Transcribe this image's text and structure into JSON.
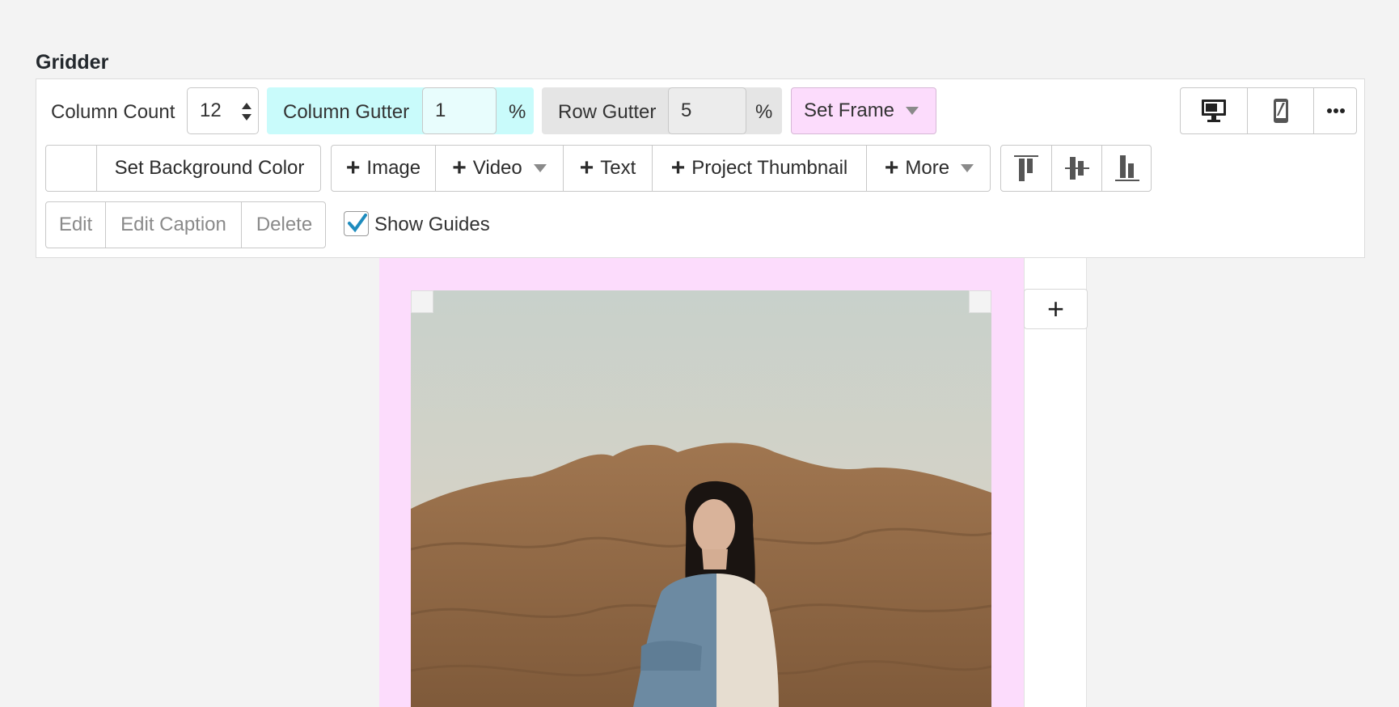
{
  "section_title": "Gridder",
  "toolbar": {
    "column_count": {
      "label": "Column Count",
      "value": "12"
    },
    "column_gutter": {
      "label": "Column Gutter",
      "value": "1",
      "unit": "%",
      "bg": "#c9fbfb"
    },
    "row_gutter": {
      "label": "Row Gutter",
      "value": "5",
      "unit": "%",
      "bg": "#e5e5e5"
    },
    "set_frame": {
      "label": "Set Frame",
      "bg": "#fcdcfc"
    },
    "view_icons": [
      "desktop-icon",
      "mobile-icon",
      "more-icon"
    ],
    "background": {
      "label": "Set Background Color"
    },
    "add_items": [
      {
        "label": "Image",
        "dropdown": false
      },
      {
        "label": "Video",
        "dropdown": true
      },
      {
        "label": "Text",
        "dropdown": false
      },
      {
        "label": "Project Thumbnail",
        "dropdown": false
      },
      {
        "label": "More",
        "dropdown": true
      }
    ],
    "align_icons": [
      "align-top-icon",
      "align-middle-icon",
      "align-bottom-icon"
    ],
    "edit_actions": {
      "edit": "Edit",
      "edit_caption": "Edit Caption",
      "delete": "Delete"
    },
    "show_guides": {
      "label": "Show Guides",
      "checked": true
    }
  },
  "canvas": {
    "frame_color": "#fcdcfc",
    "add_button_symbol": "+"
  }
}
